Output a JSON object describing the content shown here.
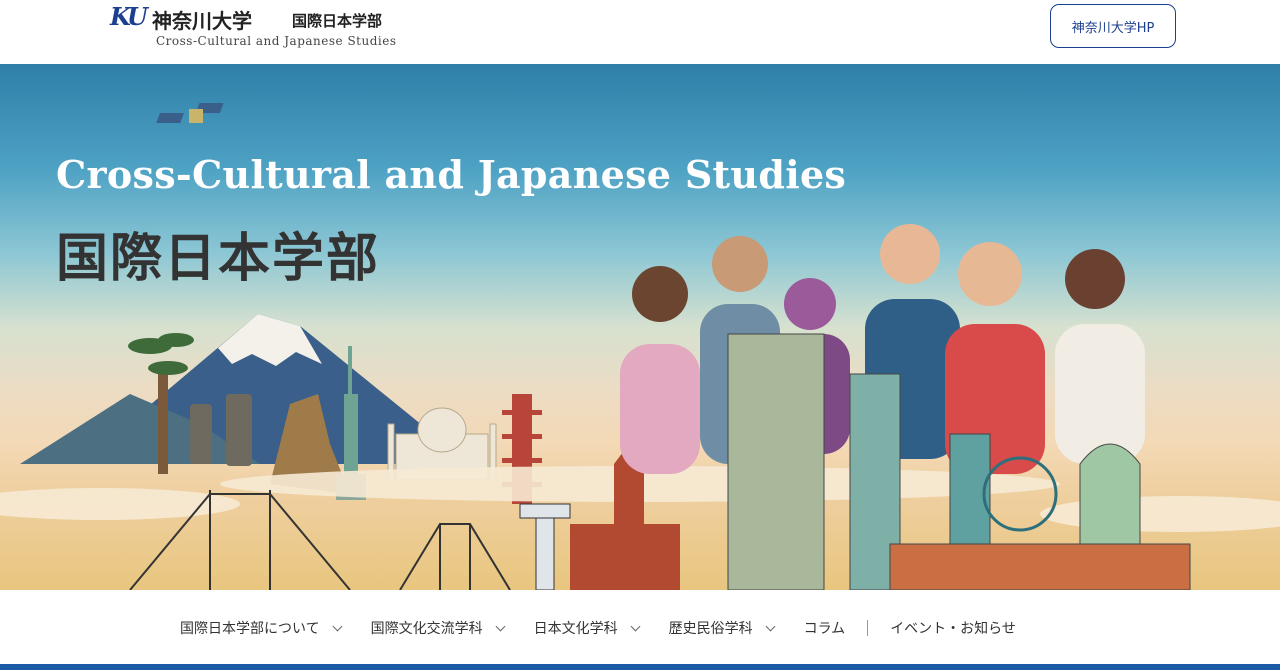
{
  "header": {
    "logo_mark": "KU",
    "university": "神奈川大学",
    "faculty": "国際日本学部",
    "subtitle": "Cross-Cultural and Japanese Studies",
    "hp_button": "神奈川大学HP"
  },
  "hero": {
    "title_en": "Cross-Cultural and Japanese Studies",
    "title_jp": "国際日本学部"
  },
  "nav": {
    "items": [
      {
        "label": "国際日本学部について",
        "icon": "chevron-down-icon"
      },
      {
        "label": "国際文化交流学科",
        "icon": "chevron-down-icon"
      },
      {
        "label": "日本文化学科",
        "icon": "chevron-down-icon"
      },
      {
        "label": "歴史民俗学科",
        "icon": "chevron-down-icon"
      },
      {
        "label": "コラム"
      },
      {
        "label": "イベント・お知らせ"
      }
    ]
  },
  "colors": {
    "brand": "#1c3f8f",
    "bottom_bar": "#1c5aa6"
  }
}
